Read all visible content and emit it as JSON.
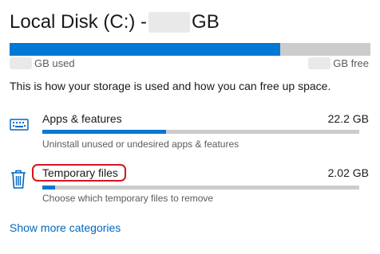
{
  "header": {
    "title_prefix": "Local Disk (C:) -",
    "title_suffix": "GB"
  },
  "storage": {
    "used_fraction": 0.75,
    "used_label": "GB used",
    "free_label": "GB free",
    "accent_color": "#0078d4"
  },
  "description": "This is how your storage is used and how you can free up space.",
  "categories": [
    {
      "name": "Apps & features",
      "size": "22.2 GB",
      "description": "Uninstall unused or undesired apps & features",
      "usage_fraction": 0.39,
      "icon": "keyboard-icon"
    },
    {
      "name": "Temporary files",
      "size": "2.02 GB",
      "description": "Choose which temporary files to remove",
      "usage_fraction": 0.04,
      "icon": "trash-icon",
      "highlight_color": "#d8141e"
    }
  ],
  "show_more": "Show more categories"
}
